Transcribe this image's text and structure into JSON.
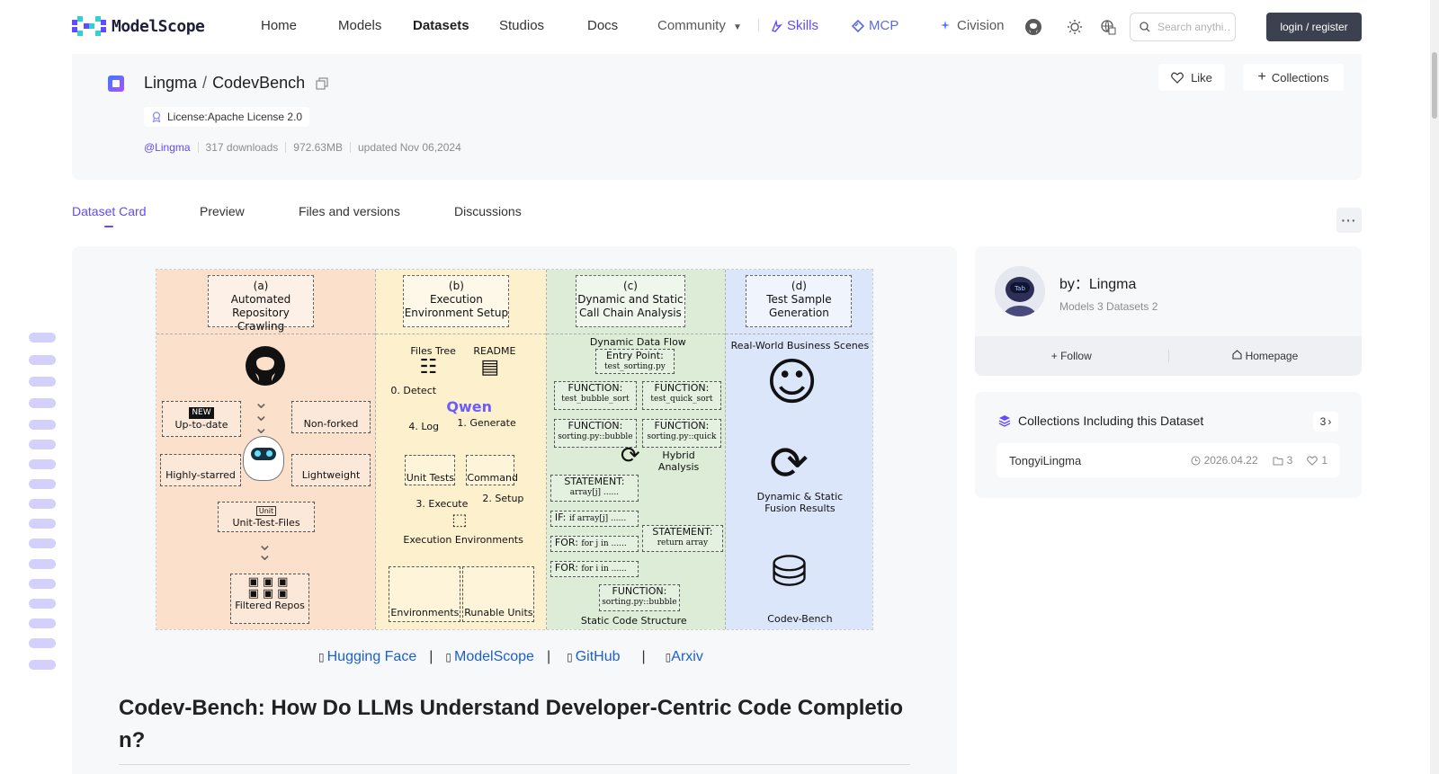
{
  "nav": {
    "brand": "ModelScope",
    "items": [
      "Home",
      "Models",
      "Datasets",
      "Studios",
      "Docs"
    ],
    "community": "Community",
    "skills": "Skills",
    "mcp": "MCP",
    "civision": "Civision",
    "search_placeholder": "Search anythi…",
    "login": "login / register"
  },
  "dataset": {
    "owner": "Lingma",
    "name": "CodevBench",
    "license": "License:Apache License 2.0",
    "owner_handle": "@Lingma",
    "downloads": "317 downloads",
    "size": "972.63MB",
    "updated": "updated Nov 06,2024",
    "like": "Like",
    "collections": "Collections"
  },
  "tabs": [
    "Dataset Card",
    "Preview",
    "Files and versions",
    "Discussions"
  ],
  "figure": {
    "headers": [
      "(a)\nAutomated\nRepository Crawling",
      "(b)\nExecution\nEnvironment Setup",
      "(c)\nDynamic and Static\nCall Chain Analysis",
      "(d)\nTest Sample\nGeneration"
    ],
    "col_a": [
      "NEW",
      "Up-to-date",
      "Non-forked",
      "Highly-starred",
      "Lightweight",
      "Unit",
      "Unit-Test-Files",
      "Filtered Repos"
    ],
    "col_b": [
      "Files Tree",
      "README",
      "0. Detect",
      "Qwen",
      "4. Log",
      "1. Generate",
      "Unit Tests",
      "Command",
      "3. Execute",
      "2. Setup",
      "Execution Environments",
      "Environments",
      "Runable Units"
    ],
    "col_c": [
      "Dynamic Data Flow",
      "Entry Point:",
      "test_sorting.py",
      "FUNCTION:",
      "test_bubble_sort",
      "test_quick_sort",
      "sorting.py::bubble",
      "sorting.py::quick",
      "Hybrid",
      "Analysis",
      "STATEMENT:",
      "array[j] ......",
      "IF:",
      "if array[j] ......",
      "FOR:",
      "for j in ......",
      "for i in ......",
      "return array",
      "Static Code Structure"
    ],
    "col_d": [
      "Real-World Business Scenes",
      "Dynamic & Static",
      "Fusion Results",
      "Codev-Bench"
    ]
  },
  "links": {
    "huggingface": "Hugging Face",
    "modelscope": "ModelScope",
    "github": "GitHub",
    "arxiv": "Arxiv"
  },
  "page_title": "Codev-Bench: How Do LLMs Understand Developer-Centric Code Completion?",
  "owner_card": {
    "name": "by：Lingma",
    "stats": "Models 3  Datasets 2",
    "follow": "Follow",
    "homepage": "Homepage"
  },
  "collections_card": {
    "title": "Collections Including this Dataset",
    "count": "3",
    "item": {
      "name": "TongyiLingma",
      "date": "2026.04.22",
      "items": "3",
      "likes": "1"
    }
  },
  "colors": {
    "accent": "#624aff",
    "link": "#1a5fd0",
    "login_bg": "#3c4150"
  }
}
